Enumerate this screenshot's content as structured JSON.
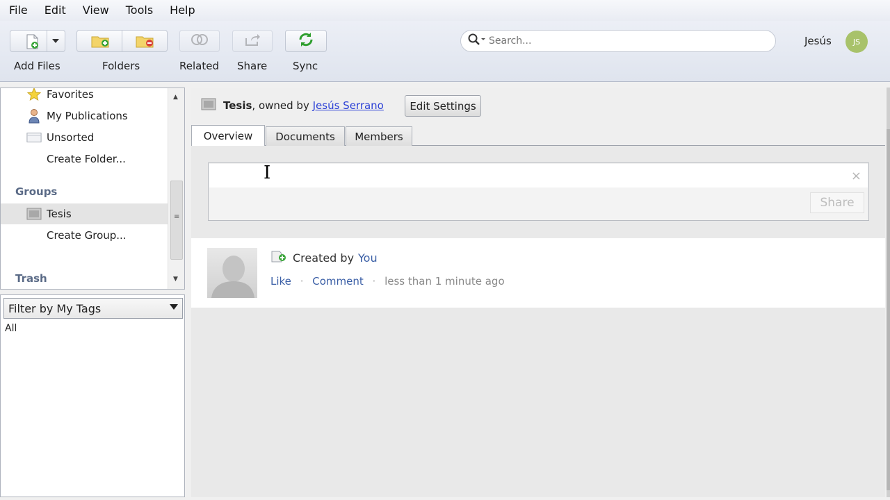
{
  "menu": [
    "File",
    "Edit",
    "View",
    "Tools",
    "Help"
  ],
  "toolbar": {
    "add_files": "Add Files",
    "folders": "Folders",
    "related": "Related",
    "share": "Share",
    "sync": "Sync"
  },
  "search": {
    "placeholder": "Search..."
  },
  "user": {
    "name": "Jesús",
    "avatar_initials": "JS"
  },
  "sidebar": {
    "items": [
      {
        "label": "Favorites",
        "icon": "star-icon"
      },
      {
        "label": "My Publications",
        "icon": "person-icon"
      },
      {
        "label": "Unsorted",
        "icon": "tray-icon"
      },
      {
        "label": "Create Folder..."
      }
    ],
    "groups_heading": "Groups",
    "groups": [
      {
        "label": "Tesis",
        "icon": "group-icon",
        "selected": true
      },
      {
        "label": "Create Group..."
      }
    ],
    "trash_heading": "Trash"
  },
  "tags": {
    "filter_label": "Filter by My Tags",
    "all": "All"
  },
  "group": {
    "name": "Tesis",
    "owned_by": ", owned by ",
    "owner": "Jesús Serrano",
    "edit_settings": "Edit Settings"
  },
  "tabs": [
    "Overview",
    "Documents",
    "Members"
  ],
  "post": {
    "close": "×",
    "share_label": "Share"
  },
  "activity": {
    "created_by": "Created by",
    "actor": "You",
    "like": "Like",
    "comment": "Comment",
    "time": "less than 1 minute ago"
  },
  "colors": {
    "link": "#2a3fd6",
    "activity_link": "#3b5fa6",
    "sync_green": "#2e9e2e",
    "avatar": "#a8c26a"
  }
}
